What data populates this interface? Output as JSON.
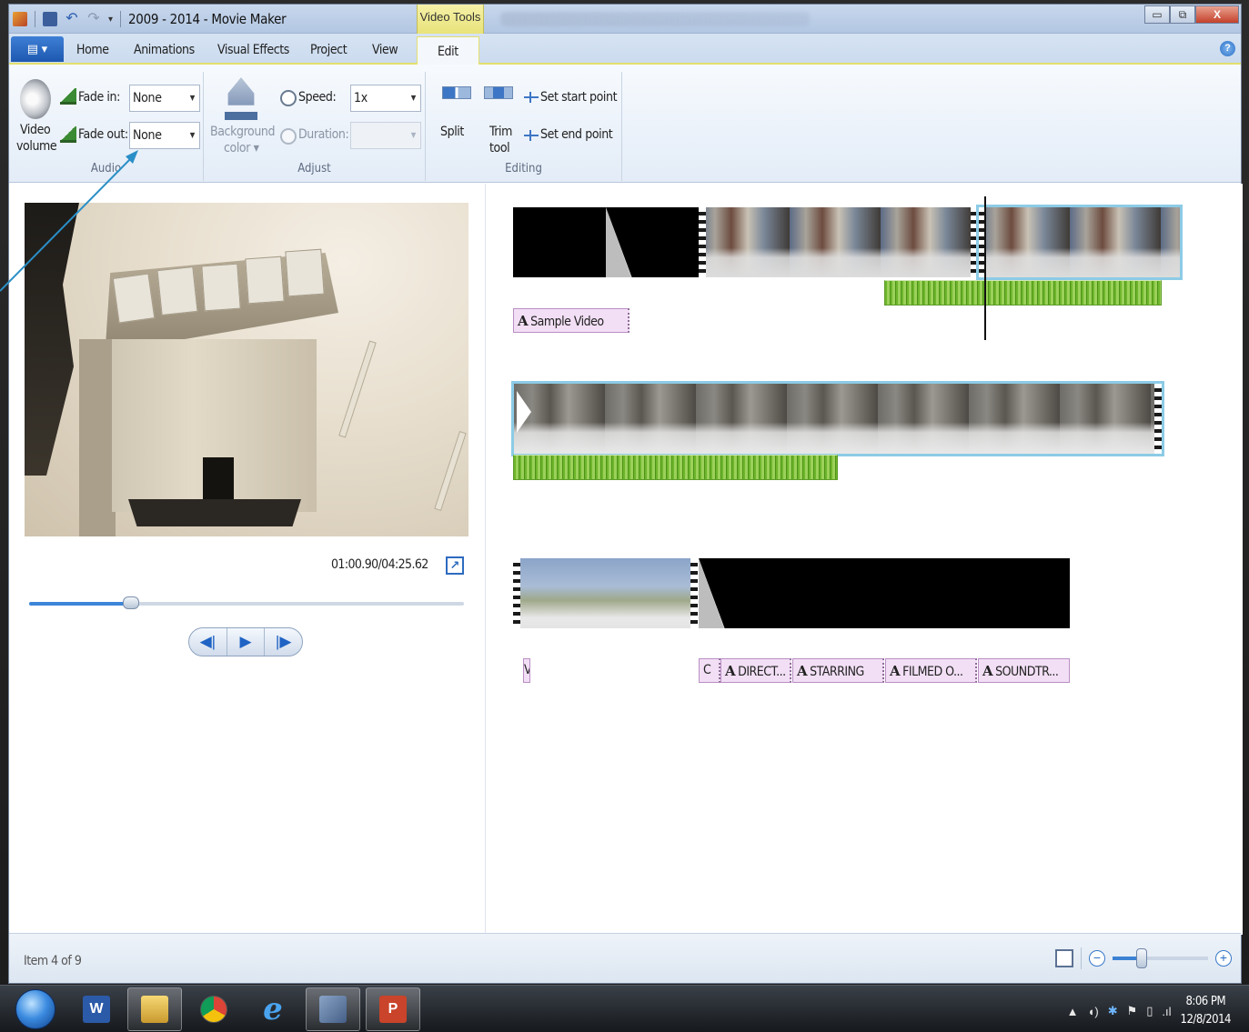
{
  "window": {
    "title": "2009 - 2014 - Movie Maker",
    "contextual_tab": "Video Tools",
    "controls": {
      "minimize": "▭",
      "restore": "⧉",
      "close": "X"
    }
  },
  "tabs": {
    "file_menu": "▤ ▾",
    "items": [
      "Home",
      "Animations",
      "Visual Effects",
      "Project",
      "View",
      "Edit"
    ],
    "active": "Edit",
    "help": "?"
  },
  "ribbon": {
    "audio": {
      "video_volume_line1": "Video",
      "video_volume_line2": "volume",
      "fade_in_label": "Fade in:",
      "fade_in_value": "None",
      "fade_out_label": "Fade out:",
      "fade_out_value": "None",
      "group_label": "Audio"
    },
    "adjust": {
      "background_color_line1": "Background",
      "background_color_line2": "color ▾",
      "speed_label": "Speed:",
      "speed_value": "1x",
      "duration_label": "Duration:",
      "duration_value": "",
      "group_label": "Adjust"
    },
    "editing": {
      "split": "Split",
      "trim_tool_line1": "Trim",
      "trim_tool_line2": "tool",
      "set_start_point": "Set start point",
      "set_end_point": "Set end point",
      "group_label": "Editing"
    }
  },
  "preview": {
    "time_readout": "01:00.90/04:25.62",
    "fullscreen_icon": "↗",
    "seek_progress": 0.235,
    "transport": {
      "prev": "◀|",
      "play": "▶",
      "next": "|▶"
    }
  },
  "storyboard": {
    "captions_row1": [
      {
        "text": "Sample Video"
      }
    ],
    "captions_row3": [
      {
        "text": "V"
      },
      {
        "text": "C"
      },
      {
        "text": "DIRECT..."
      },
      {
        "text": "STARRING"
      },
      {
        "text": "FILMED O..."
      },
      {
        "text": "SOUNDTR..."
      }
    ],
    "caption_icon": "A"
  },
  "statusbar": {
    "item_text": "Item 4 of 9",
    "zoom_minus": "−",
    "zoom_plus": "+",
    "zoom_level": 0.3
  },
  "taskbar": {
    "apps": [
      "Word",
      "File Explorer",
      "Chrome",
      "Internet Explorer",
      "Movie Maker",
      "PowerPoint"
    ],
    "word_glyph": "W",
    "ie_glyph": "e",
    "ppt_glyph": "P",
    "tray_up": "▲",
    "clock_time": "8:06 PM",
    "clock_date": "12/8/2014"
  }
}
